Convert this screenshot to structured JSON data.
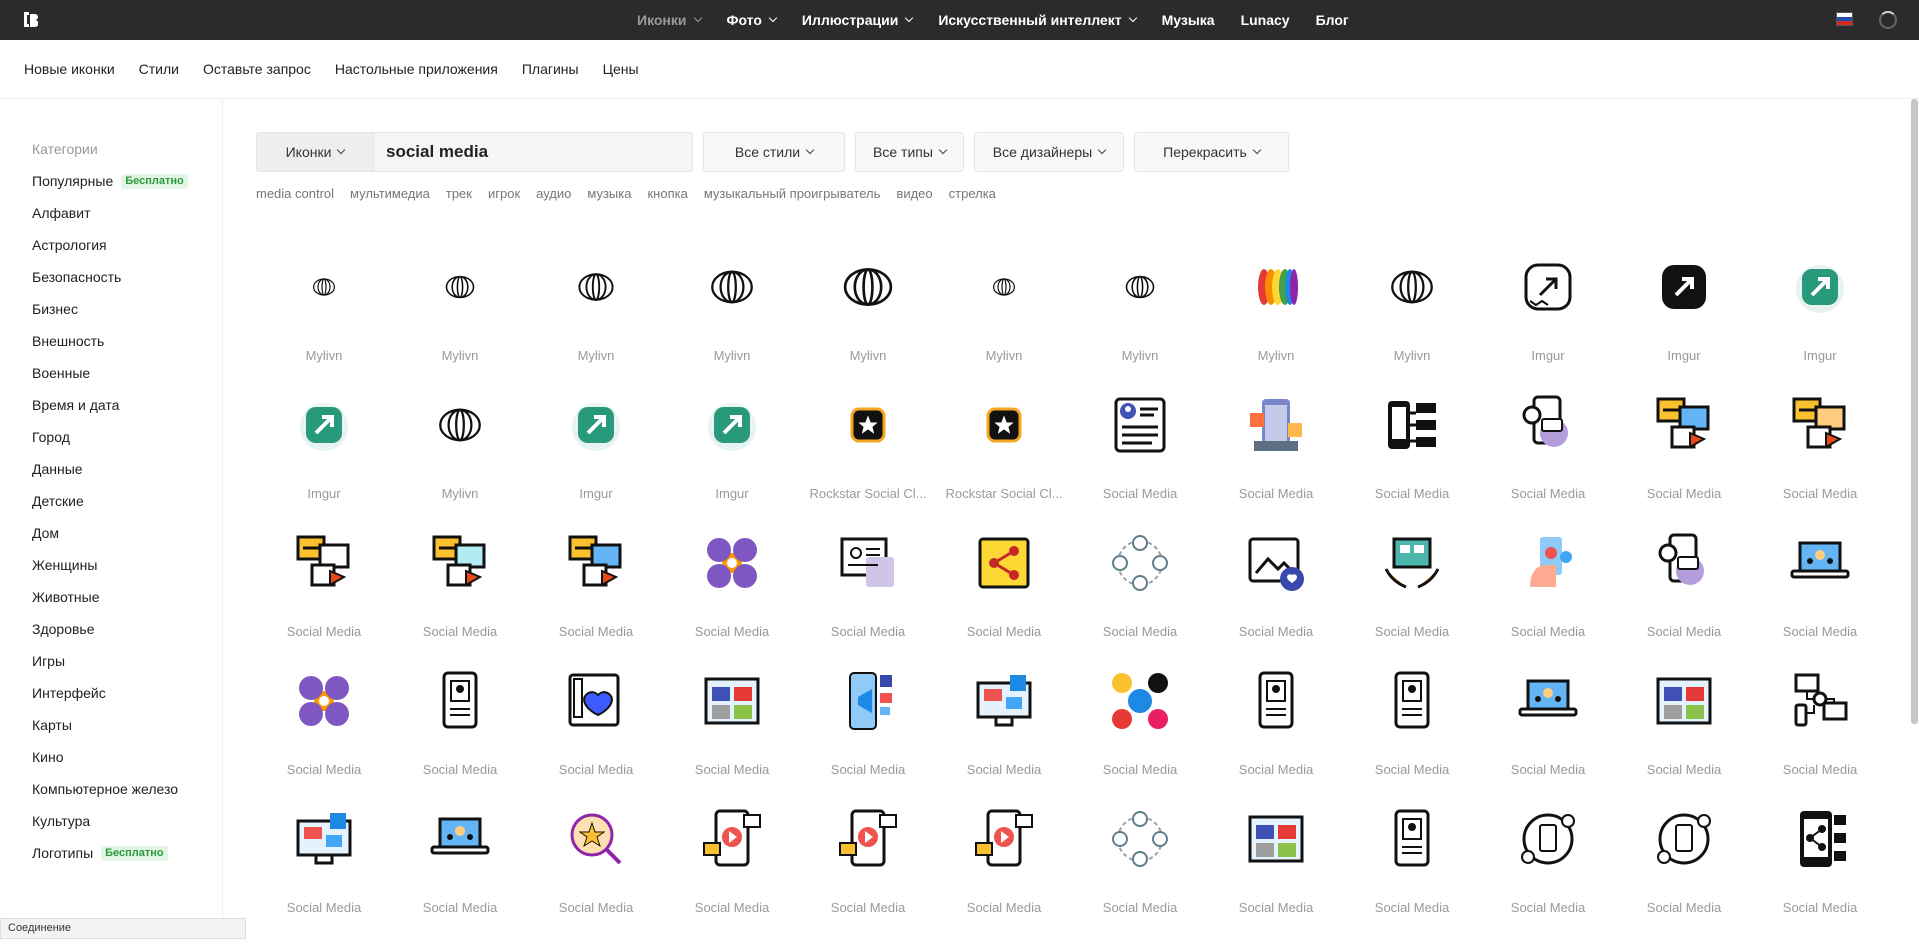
{
  "topbar": {
    "nav": [
      {
        "label": "Иконки",
        "dropdown": true,
        "muted": true
      },
      {
        "label": "Фото",
        "dropdown": true
      },
      {
        "label": "Иллюстрации",
        "dropdown": true
      },
      {
        "label": "Искусственный интеллект",
        "dropdown": true
      },
      {
        "label": "Музыка",
        "dropdown": false
      },
      {
        "label": "Lunacy",
        "dropdown": false
      },
      {
        "label": "Блог",
        "dropdown": false
      }
    ]
  },
  "subnav": {
    "items": [
      "Новые иконки",
      "Стили",
      "Оставьте запрос",
      "Настольные приложения",
      "Плагины",
      "Цены"
    ]
  },
  "sidebar": {
    "title": "Категории",
    "items": [
      {
        "label": "Популярные",
        "badge": "Бесплатно"
      },
      {
        "label": "Алфавит"
      },
      {
        "label": "Астрология"
      },
      {
        "label": "Безопасность"
      },
      {
        "label": "Бизнес"
      },
      {
        "label": "Внешность"
      },
      {
        "label": "Военные"
      },
      {
        "label": "Время и дата"
      },
      {
        "label": "Город"
      },
      {
        "label": "Данные"
      },
      {
        "label": "Детские"
      },
      {
        "label": "Дом"
      },
      {
        "label": "Женщины"
      },
      {
        "label": "Животные"
      },
      {
        "label": "Здоровье"
      },
      {
        "label": "Игры"
      },
      {
        "label": "Интерфейс"
      },
      {
        "label": "Карты"
      },
      {
        "label": "Кино"
      },
      {
        "label": "Компьютерное железо"
      },
      {
        "label": "Культура"
      },
      {
        "label": "Логотипы",
        "badge": "Бесплатно"
      }
    ]
  },
  "search": {
    "type_label": "Иконки",
    "value": "social media",
    "filters": [
      "Все стили",
      "Все типы",
      "Все дизайнеры",
      "Перекрасить"
    ]
  },
  "tags": [
    "media control",
    "мультимедиа",
    "трек",
    "игрок",
    "аудио",
    "музыка",
    "кнопка",
    "музыкальный проигрыватель",
    "видео",
    "стрелка"
  ],
  "icons": [
    {
      "label": "Mylivn",
      "icon": "mylivn-logo"
    },
    {
      "label": "Mylivn",
      "icon": "mylivn-logo"
    },
    {
      "label": "Mylivn",
      "icon": "mylivn-logo"
    },
    {
      "label": "Mylivn",
      "icon": "mylivn-logo"
    },
    {
      "label": "Mylivn",
      "icon": "mylivn-logo"
    },
    {
      "label": "Mylivn",
      "icon": "mylivn-logo"
    },
    {
      "label": "Mylivn",
      "icon": "mylivn-logo"
    },
    {
      "label": "Mylivn",
      "icon": "mylivn-logo-color"
    },
    {
      "label": "Mylivn",
      "icon": "mylivn-logo"
    },
    {
      "label": "Imgur",
      "icon": "imgur-outline"
    },
    {
      "label": "Imgur",
      "icon": "imgur-filled"
    },
    {
      "label": "Imgur",
      "icon": "imgur-color"
    },
    {
      "label": "Imgur",
      "icon": "imgur-color"
    },
    {
      "label": "Mylivn",
      "icon": "mylivn-logo"
    },
    {
      "label": "Imgur",
      "icon": "imgur-color"
    },
    {
      "label": "Imgur",
      "icon": "imgur-color"
    },
    {
      "label": "Rockstar Social Cl...",
      "icon": "rockstar-star"
    },
    {
      "label": "Rockstar Social Cl...",
      "icon": "rockstar-star"
    },
    {
      "label": "Social Media",
      "icon": "profile-card"
    },
    {
      "label": "Social Media",
      "icon": "phone-apps"
    },
    {
      "label": "Social Media",
      "icon": "phone-network"
    },
    {
      "label": "Social Media",
      "icon": "phone-chat"
    },
    {
      "label": "Social Media",
      "icon": "message-bubbles"
    },
    {
      "label": "Social Media",
      "icon": "message-bubbles"
    },
    {
      "label": "Social Media",
      "icon": "message-bubbles"
    },
    {
      "label": "Social Media",
      "icon": "message-bubbles"
    },
    {
      "label": "Social Media",
      "icon": "message-bubbles"
    },
    {
      "label": "Social Media",
      "icon": "social-networks-gear"
    },
    {
      "label": "Social Media",
      "icon": "profile-window"
    },
    {
      "label": "Social Media",
      "icon": "share-square"
    },
    {
      "label": "Social Media",
      "icon": "network-circle"
    },
    {
      "label": "Social Media",
      "icon": "image-heart"
    },
    {
      "label": "Social Media",
      "icon": "hands-tablet"
    },
    {
      "label": "Social Media",
      "icon": "hand-phone"
    },
    {
      "label": "Social Media",
      "icon": "phone-chat"
    },
    {
      "label": "Social Media",
      "icon": "laptop-network"
    },
    {
      "label": "Social Media",
      "icon": "social-networks-gear"
    },
    {
      "label": "Social Media",
      "icon": "phone-profile"
    },
    {
      "label": "Social Media",
      "icon": "phone-heart"
    },
    {
      "label": "Social Media",
      "icon": "window-apps"
    },
    {
      "label": "Social Media",
      "icon": "phone-megaphone"
    },
    {
      "label": "Social Media",
      "icon": "monitor-video"
    },
    {
      "label": "Social Media",
      "icon": "world-social"
    },
    {
      "label": "Social Media",
      "icon": "phone-profile"
    },
    {
      "label": "Social Media",
      "icon": "phone-profile"
    },
    {
      "label": "Social Media",
      "icon": "laptop-network"
    },
    {
      "label": "Social Media",
      "icon": "window-apps"
    },
    {
      "label": "Social Media",
      "icon": "network-devices"
    },
    {
      "label": "Social Media",
      "icon": "monitor-video"
    },
    {
      "label": "Social Media",
      "icon": "laptop-network"
    },
    {
      "label": "Social Media",
      "icon": "star-search"
    },
    {
      "label": "Social Media",
      "icon": "phone-video"
    },
    {
      "label": "Social Media",
      "icon": "phone-video"
    },
    {
      "label": "Social Media",
      "icon": "phone-video"
    },
    {
      "label": "Social Media",
      "icon": "network-circle"
    },
    {
      "label": "Social Media",
      "icon": "window-apps"
    },
    {
      "label": "Social Media",
      "icon": "phone-profile"
    },
    {
      "label": "Social Media",
      "icon": "share-circle"
    },
    {
      "label": "Social Media",
      "icon": "share-circle"
    },
    {
      "label": "Social Media",
      "icon": "phone-share"
    }
  ],
  "status_bar": "Соединение",
  "colors": {
    "topbar_bg": "#2b2b2b",
    "badge_green": "#2a9a3b",
    "label_gray": "#9a9a9a"
  }
}
